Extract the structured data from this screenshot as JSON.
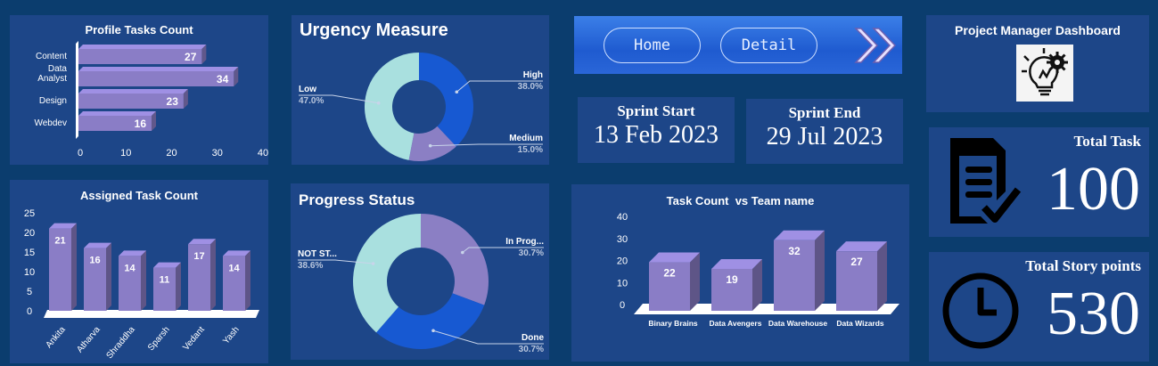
{
  "colors": {
    "page_bg": "#0b3d6e",
    "panel_bg": "#1d4688",
    "bar_fill": "#8a7dc6",
    "donut_teal": "#a9e0df",
    "donut_blue": "#1759d2",
    "donut_purple": "#8b7fc4"
  },
  "profile": {
    "title": "Profile Tasks Count",
    "chart_data": {
      "type": "bar",
      "orientation": "horizontal",
      "categories": [
        "Content",
        "Data Analyst",
        "Design",
        "Webdev"
      ],
      "values": [
        27,
        34,
        23,
        16
      ],
      "ticks": [
        "0",
        "10",
        "20",
        "30",
        "40"
      ],
      "xlim": [
        0,
        40
      ]
    }
  },
  "assigned": {
    "title": "Assigned Task Count",
    "chart_data": {
      "type": "bar",
      "categories": [
        "Ankita",
        "Atharva",
        "Shraddha",
        "Sparsh",
        "Vedant",
        "Yash"
      ],
      "values": [
        21,
        16,
        14,
        11,
        17,
        14
      ],
      "ticks": [
        "0",
        "5",
        "10",
        "15",
        "20",
        "25"
      ],
      "ylim": [
        0,
        25
      ]
    }
  },
  "urgency": {
    "title": "Urgency Measure",
    "chart_data": {
      "type": "pie",
      "slices": [
        {
          "name": "High",
          "pct_label": "38.0%",
          "value": 38.0
        },
        {
          "name": "Medium",
          "pct_label": "15.0%",
          "value": 15.0
        },
        {
          "name": "Low",
          "pct_label": "47.0%",
          "value": 47.0
        }
      ]
    }
  },
  "progress": {
    "title": "Progress Status",
    "chart_data": {
      "type": "pie",
      "slices": [
        {
          "name": "In Prog...",
          "pct_label": "30.7%",
          "value": 30.7
        },
        {
          "name": "Done",
          "pct_label": "30.7%",
          "value": 30.7
        },
        {
          "name": "NOT ST...",
          "pct_label": "38.6%",
          "value": 38.6
        }
      ]
    }
  },
  "nav": {
    "home": "Home",
    "detail": "Detail"
  },
  "sprint": {
    "start_label": "Sprint Start",
    "start_value": "13 Feb 2023",
    "end_label": "Sprint End",
    "end_value": "29 Jul 2023"
  },
  "team": {
    "title": "Task Count  vs Team name",
    "chart_data": {
      "type": "bar",
      "categories": [
        "Binary Brains",
        "Data Avengers",
        "Data Warehouse",
        "Data Wizards"
      ],
      "values": [
        22,
        19,
        32,
        27
      ],
      "ticks": [
        "0",
        "10",
        "20",
        "30",
        "40"
      ],
      "ylim": [
        0,
        40
      ]
    }
  },
  "dashboard": {
    "title": "Project Manager Dashboard"
  },
  "kpi": {
    "total_task_label": "Total Task",
    "total_task_value": "100",
    "story_points_label": "Total Story points",
    "story_points_value": "530"
  }
}
